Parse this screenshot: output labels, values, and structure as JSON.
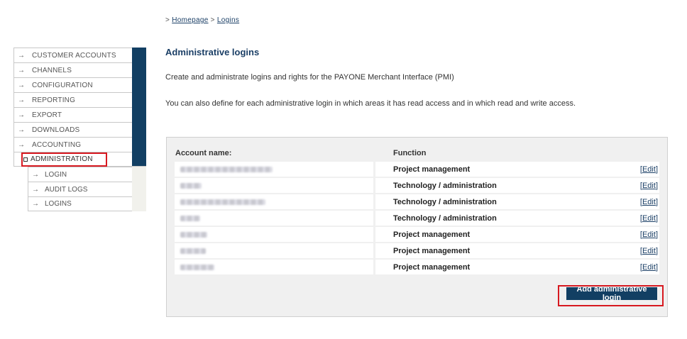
{
  "breadcrumb": {
    "prefix": ">",
    "items": [
      {
        "label": "Homepage"
      },
      {
        "label": "Logins"
      }
    ],
    "separator": ">"
  },
  "nav": {
    "arrow_glyph": "→",
    "items": [
      {
        "label": "CUSTOMER ACCOUNTS"
      },
      {
        "label": "CHANNELS"
      },
      {
        "label": "CONFIGURATION"
      },
      {
        "label": "REPORTING"
      },
      {
        "label": "EXPORT"
      },
      {
        "label": "DOWNLOADS"
      },
      {
        "label": "ACCOUNTING"
      },
      {
        "label": "ADMINISTRATION",
        "active": true
      }
    ],
    "subitems": [
      {
        "label": "LOGIN"
      },
      {
        "label": "AUDIT LOGS"
      },
      {
        "label": "LOGINS"
      }
    ]
  },
  "main": {
    "title": "Administrative logins",
    "intro1": "Create and administrate logins and rights for the PAYONE Merchant Interface (PMI)",
    "intro2": "You can also define for each administrative login in which areas it has read access and in which read and write access."
  },
  "table": {
    "headers": {
      "account": "Account name:",
      "function": "Function"
    },
    "rows": [
      {
        "account_blur_width": 130,
        "function": "Project management",
        "action": "Edit"
      },
      {
        "account_blur_width": 30,
        "function": "Technology / administration",
        "action": "Edit"
      },
      {
        "account_blur_width": 120,
        "function": "Technology / administration",
        "action": "Edit"
      },
      {
        "account_blur_width": 28,
        "function": "Technology / administration",
        "action": "Edit"
      },
      {
        "account_blur_width": 38,
        "function": "Project management",
        "action": "Edit"
      },
      {
        "account_blur_width": 36,
        "function": "Project management",
        "action": "Edit"
      },
      {
        "account_blur_width": 48,
        "function": "Project management",
        "action": "Edit"
      }
    ]
  },
  "actions": {
    "add_login_label": "Add administrative login"
  },
  "colors": {
    "brand_navy": "#123f63",
    "highlight_red": "#d71920"
  }
}
